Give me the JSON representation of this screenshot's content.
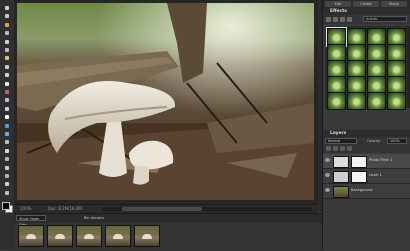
{
  "toolbox": {
    "tools": [
      "move-tool",
      "zoom-tool",
      "hand-tool",
      "eyedropper-tool",
      "marquee-tool",
      "lasso-tool",
      "magic-wand-tool",
      "quick-selection-tool",
      "crop-tool",
      "type-tool",
      "red-eye-tool",
      "healing-brush-tool",
      "clone-stamp-tool",
      "eraser-tool",
      "brush-tool",
      "smart-brush-tool",
      "paint-bucket-tool",
      "gradient-tool",
      "shape-tool",
      "blur-tool",
      "sponge-tool",
      "pencil-tool",
      "custom-shape-tool"
    ]
  },
  "document": {
    "zoom": "100%",
    "info": "Doc: 8.2M/16.4M"
  },
  "project_bin": {
    "show": "Show Open Files",
    "actions": "Bin Actions"
  },
  "panels": {
    "tabs": [
      "Edit",
      "Create",
      "Share"
    ],
    "effects_title": "Effects",
    "effects_filter": "Artistic",
    "effects_count": 20,
    "layers_title": "Layers",
    "blend_mode": "Normal",
    "opacity_label": "Opacity:",
    "opacity_value": "100%",
    "layers": [
      {
        "name": "Photo Filter 1"
      },
      {
        "name": "Level 1"
      },
      {
        "name": "Background"
      }
    ]
  }
}
